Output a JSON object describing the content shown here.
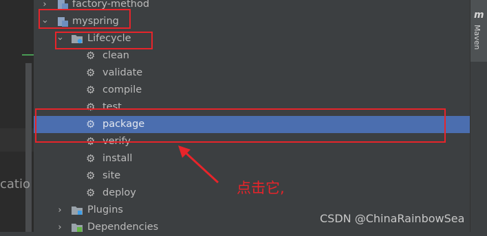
{
  "left_panel": {
    "cutoff_text": "catio"
  },
  "tree": {
    "factory_method": "factory-method",
    "myspring": "myspring",
    "lifecycle": "Lifecycle",
    "goals": [
      "clean",
      "validate",
      "compile",
      "test",
      "package",
      "verify",
      "install",
      "site",
      "deploy"
    ],
    "selected_goal": "package",
    "plugins": "Plugins",
    "dependencies": "Dependencies"
  },
  "side_tab": {
    "icon": "maven-m-icon",
    "glyph": "m",
    "label": "Maven"
  },
  "annotation": {
    "text": "点击它,",
    "color": "#e8242a"
  },
  "watermark": "CSDN @ChinaRainbowSea",
  "colors": {
    "selection": "#4b6eaf",
    "annotation_red": "#e8242a",
    "panel_bg": "#3c3f41"
  }
}
